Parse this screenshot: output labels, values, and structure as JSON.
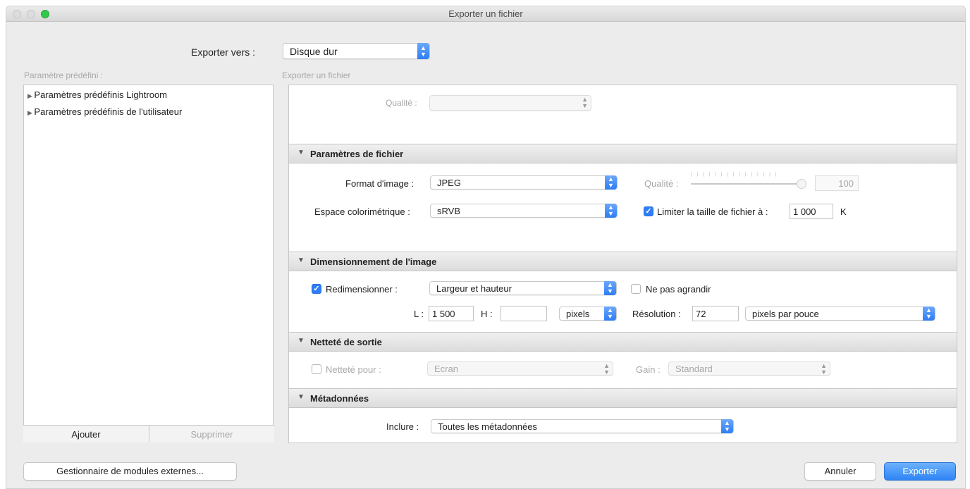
{
  "window": {
    "title": "Exporter un fichier"
  },
  "export_to": {
    "label": "Exporter vers :",
    "value": "Disque dur"
  },
  "presets": {
    "label": "Paramètre prédéfini :",
    "items": [
      "Paramètres prédéfinis Lightroom",
      "Paramètres prédéfinis de l'utilisateur"
    ],
    "add": "Ajouter",
    "remove": "Supprimer"
  },
  "main": {
    "subtitle": "Exporter un fichier",
    "quality_label": "Qualité :",
    "quality_value": ""
  },
  "file_settings": {
    "title": "Paramètres de fichier",
    "format_label": "Format d'image :",
    "format_value": "JPEG",
    "quality_label": "Qualité :",
    "quality_value": "100",
    "quality_level": 1.0,
    "colorspace_label": "Espace colorimétrique :",
    "colorspace_value": "sRVB",
    "limit_label": "Limiter la taille de fichier à :",
    "limit_checked": true,
    "limit_value": "1 000",
    "limit_unit": "K"
  },
  "sizing": {
    "title": "Dimensionnement de l'image",
    "resize_label": "Redimensionner :",
    "resize_checked": true,
    "resize_mode": "Largeur et hauteur",
    "no_enlarge_label": "Ne pas agrandir",
    "no_enlarge_checked": false,
    "w_label": "L :",
    "w_value": "1 500",
    "h_label": "H :",
    "h_value": "",
    "unit_value": "pixels",
    "res_label": "Résolution :",
    "res_value": "72",
    "res_unit": "pixels par pouce"
  },
  "sharpen": {
    "title": "Netteté de sortie",
    "for_label": "Netteté pour :",
    "for_checked": false,
    "for_value": "Ecran",
    "gain_label": "Gain :",
    "gain_value": "Standard"
  },
  "metadata": {
    "title": "Métadonnées",
    "include_label": "Inclure :",
    "include_value": "Toutes les métadonnées"
  },
  "footer": {
    "plugins": "Gestionnaire de modules externes...",
    "cancel": "Annuler",
    "export": "Exporter"
  },
  "colors": {
    "accent": "#2f7ef6",
    "close_dot": "#dcdcdc",
    "zoom_dot": "#34c84a"
  }
}
